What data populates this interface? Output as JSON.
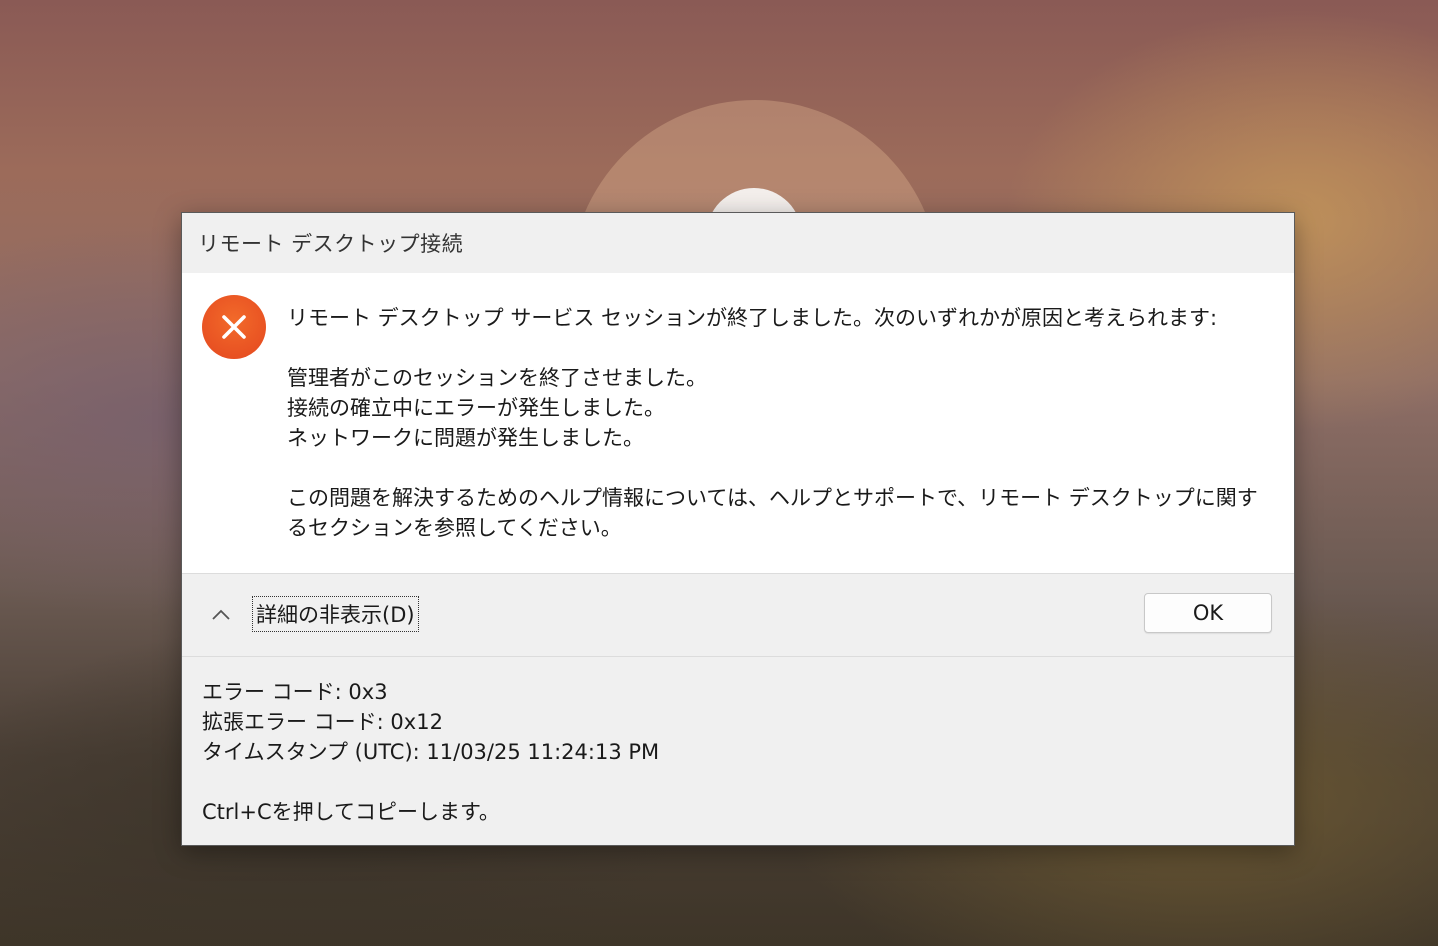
{
  "window": {
    "title": "リモート デスクトップ接続"
  },
  "message": {
    "headline": "リモート デスクトップ サービス セッションが終了しました。次のいずれかが原因と考えられます:",
    "reasons": [
      "管理者がこのセッションを終了させました。",
      "接続の確立中にエラーが発生しました。",
      "ネットワークに問題が発生しました。"
    ],
    "help": "この問題を解決するためのヘルプ情報については、ヘルプとサポートで、リモート デスクトップに関するセクションを参照してください。"
  },
  "footer": {
    "details_toggle_label": "詳細の非表示(D)",
    "ok_label": "OK"
  },
  "details": {
    "error_code": "エラー コード: 0x3",
    "extended_error_code": "拡張エラー コード: 0x12",
    "timestamp": "タイムスタンプ (UTC): 11/03/25 11:24:13 PM",
    "copy_hint": "Ctrl+Cを押してコピーします。"
  },
  "icons": {
    "error": "error-icon",
    "chevron": "chevron-up-icon"
  },
  "colors": {
    "error_icon": "#e94e1b"
  }
}
